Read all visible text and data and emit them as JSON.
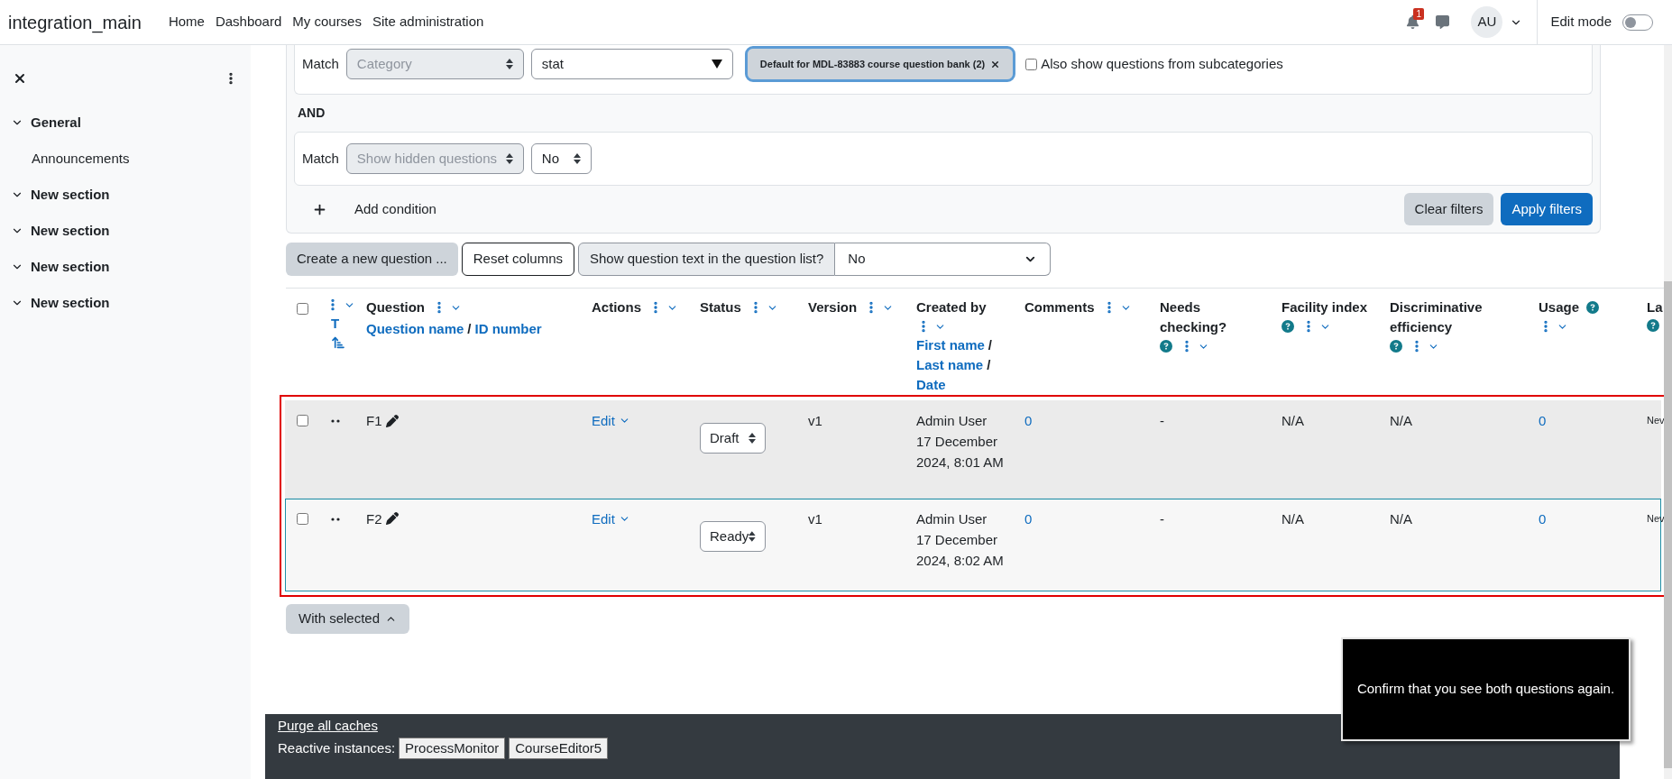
{
  "navbar": {
    "site_name": "integration_main",
    "links": [
      "Home",
      "Dashboard",
      "My courses",
      "Site administration"
    ],
    "notification_count": "1",
    "avatar_initials": "AU",
    "edit_mode_label": "Edit mode",
    "edit_mode_on": false
  },
  "sidebar": {
    "sections": [
      {
        "title": "General",
        "expanded": true,
        "children": [
          {
            "title": "Announcements"
          }
        ]
      },
      {
        "title": "New section",
        "expanded": true
      },
      {
        "title": "New section",
        "expanded": true
      },
      {
        "title": "New section",
        "expanded": true
      },
      {
        "title": "New section",
        "expanded": true
      }
    ]
  },
  "filters": {
    "conditions": [
      {
        "kind": "category",
        "label": "Match",
        "field": "Category",
        "value": "stat",
        "chip": "Default for MDL-83883 course question bank (2)",
        "checkbox_label": "Also show questions from subcategories",
        "checkbox_checked": false
      },
      {
        "kind": "select",
        "label": "Match",
        "field": "Show hidden questions",
        "value": "No"
      }
    ],
    "joiner": "AND",
    "add_condition": "Add condition",
    "clear": "Clear filters",
    "apply": "Apply filters"
  },
  "toolbar": {
    "create": "Create a new question ...",
    "reset": "Reset columns",
    "show_text_label": "Show question text in the question list?",
    "show_text_value": "No"
  },
  "table": {
    "sort_separator": "/",
    "columns": [
      {
        "kind": "checkbox",
        "checked": false
      },
      {
        "kind": "type",
        "sort_links": [
          "T"
        ],
        "menu": true,
        "help": false
      },
      {
        "kind": "text",
        "title": "Question",
        "sort_links": [
          "Question name",
          "ID number"
        ],
        "menu": true,
        "help": false
      },
      {
        "kind": "text",
        "title": "Actions",
        "menu": true,
        "help": false
      },
      {
        "kind": "text",
        "title": "Status",
        "menu": true,
        "help": false
      },
      {
        "kind": "text",
        "title": "Version",
        "menu": true,
        "help": false
      },
      {
        "kind": "text",
        "title": "Created by",
        "sort_links": [
          "First name",
          "Last name",
          "Date"
        ],
        "menu": true,
        "help": false
      },
      {
        "kind": "text",
        "title": "Comments",
        "menu": true,
        "help": false
      },
      {
        "kind": "text",
        "title": "Needs checking?",
        "menu": true,
        "help": true
      },
      {
        "kind": "text",
        "title": "Facility index",
        "menu": true,
        "help": true
      },
      {
        "kind": "text",
        "title": "Discriminative efficiency",
        "menu": true,
        "help": true
      },
      {
        "kind": "text",
        "title": "Usage",
        "menu": true,
        "help": true
      },
      {
        "kind": "text",
        "title": "La",
        "menu": false,
        "help": true
      }
    ],
    "rows": [
      {
        "checked": false,
        "hovered": true,
        "focused": false,
        "name": "F1",
        "action": "Edit",
        "status": "Draft",
        "version": "v1",
        "created_by": "Admin User",
        "created_date": "17 December 2024, 8:01 AM",
        "comments": "0",
        "needs_checking": "-",
        "facility_index": "N/A",
        "discrimination": "N/A",
        "usage": "0",
        "last": "Nev"
      },
      {
        "checked": false,
        "hovered": false,
        "focused": true,
        "name": "F2",
        "action": "Edit",
        "status": "Ready",
        "version": "v1",
        "created_by": "Admin User",
        "created_date": "17 December 2024, 8:02 AM",
        "comments": "0",
        "needs_checking": "-",
        "facility_index": "N/A",
        "discrimination": "N/A",
        "usage": "0",
        "last": "Nev"
      }
    ]
  },
  "with_selected": "With selected",
  "tooltip": "Confirm that you see both questions again.",
  "footer": {
    "purge": "Purge all caches",
    "reactive_label": "Reactive instances:",
    "instances": [
      "ProcessMonitor",
      "CourseEditor5"
    ]
  }
}
